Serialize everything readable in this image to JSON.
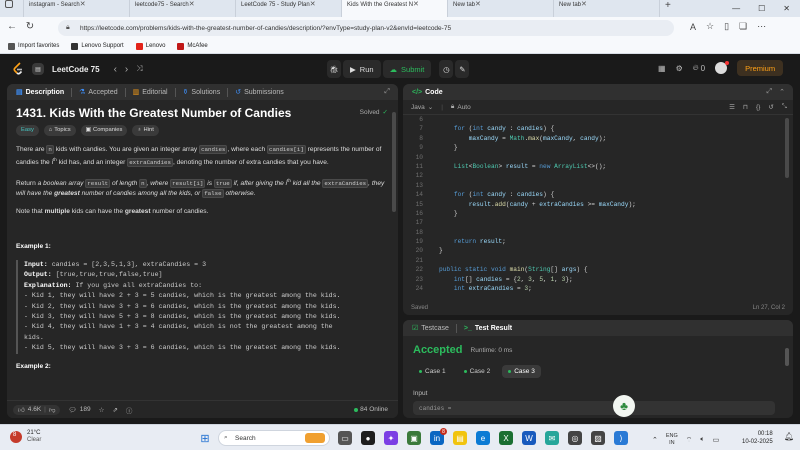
{
  "browser": {
    "tabs": [
      {
        "title": "instagram - Search",
        "active": false,
        "color": "#1a73e8"
      },
      {
        "title": "leetcode75 - Search",
        "active": false,
        "color": "#1a73e8"
      },
      {
        "title": "LeetCode 75 - Study Plan",
        "active": false,
        "color": "#ffa116"
      },
      {
        "title": "Kids With the Greatest N",
        "active": true,
        "color": "#ffa116"
      },
      {
        "title": "New tab",
        "active": false,
        "color": "#888888"
      },
      {
        "title": "New tab",
        "active": false,
        "color": "#888888"
      }
    ],
    "new_tab": "+",
    "url": "https://leetcode.com/problems/kids-with-the-greatest-number-of-candies/description/?envType=study-plan-v2&envId=leetcode-75",
    "bookmarks": [
      {
        "label": "Import favorites",
        "color": "#555555"
      },
      {
        "label": "Lenovo Support",
        "color": "#333333"
      },
      {
        "label": "Lenovo",
        "color": "#e2231a"
      },
      {
        "label": "McAfee",
        "color": "#c01818"
      }
    ]
  },
  "lc_header": {
    "title": "LeetCode 75",
    "run": "Run",
    "submit": "Submit",
    "streak": "0",
    "premium": "Premium"
  },
  "description": {
    "tabs": [
      "Description",
      "Accepted",
      "Editorial",
      "Solutions",
      "Submissions"
    ],
    "problem_title": "1431. Kids With the Greatest Number of Candies",
    "status": "Solved",
    "pills": [
      "Easy",
      "Topics",
      "Companies",
      "Hint"
    ],
    "p1": {
      "a": "There are ",
      "n": "n",
      "b": " kids with candies. You are given an integer array ",
      "candies": "candies",
      "c": ", where each ",
      "candies_i": "candies[i]",
      "d": " represents the number of candies the ",
      "ith": "i",
      "th": "th",
      "e": " kid has, and an integer ",
      "extra": "extraCandies",
      "f": ", denoting the number of extra candies that you have."
    },
    "p2": {
      "a": "Return ",
      "b": "a boolean array ",
      "result": "result",
      "c": " of length ",
      "n": "n",
      "d": ", where ",
      "result_i": "result[i]",
      "e": " is ",
      "true": "true",
      "f": " if, after giving the ",
      "ith": "i",
      "th": "th",
      "g": " kid all the ",
      "extra": "extraCandies",
      "h": ", they will have the ",
      "greatest": "greatest",
      "i": " number of candies among all the kids, or ",
      "false": "false",
      "j": " otherwise."
    },
    "p3": {
      "a": "Note that ",
      "multiple": "multiple",
      "b": " kids can have the ",
      "greatest": "greatest",
      "c": " number of candies."
    },
    "example1_title": "Example 1:",
    "example1": {
      "input_label": "Input:",
      "input": " candies = [2,3,5,1,3], extraCandies = 3",
      "output_label": "Output:",
      "output": " [true,true,true,false,true]",
      "expl_label": "Explanation:",
      "expl": " If you give all extraCandies to:",
      "lines": [
        "- Kid 1, they will have 2 + 3 = 5 candies, which is the greatest among the kids.",
        "- Kid 2, they will have 3 + 3 = 6 candies, which is the greatest among the kids.",
        "- Kid 3, they will have 5 + 3 = 8 candies, which is the greatest among the kids.",
        "- Kid 4, they will have 1 + 3 = 4 candies, which is not the greatest among the",
        "kids.",
        "- Kid 5, they will have 3 + 3 = 6 candies, which is the greatest among the kids."
      ]
    },
    "example2_title": "Example 2:",
    "footer": {
      "likes": "4.6K",
      "comments": "189",
      "online": "84 Online"
    }
  },
  "code": {
    "title": "Code",
    "language": "Java",
    "mode": "Auto",
    "lines": [
      {
        "n": "6",
        "html": ""
      },
      {
        "n": "7",
        "html": "    <span class='kw'>for</span> (<span class='kw'>int</span> <span class='vr'>candy</span> : <span class='vr'>candies</span>) {"
      },
      {
        "n": "8",
        "html": "        <span class='vr'>maxCandy</span> = <span class='ty'>Math</span>.<span class='fn'>max</span>(<span class='vr'>maxCandy</span>, <span class='vr'>candy</span>);"
      },
      {
        "n": "9",
        "html": "    }"
      },
      {
        "n": "10",
        "html": ""
      },
      {
        "n": "11",
        "html": "    <span class='ty'>List</span>&lt;<span class='ty'>Boolean</span>&gt; <span class='vr'>result</span> = <span class='kw'>new</span> <span class='ty'>ArrayList</span>&lt;&gt;();"
      },
      {
        "n": "12",
        "html": ""
      },
      {
        "n": "13",
        "html": ""
      },
      {
        "n": "14",
        "html": "    <span class='kw'>for</span> (<span class='kw'>int</span> <span class='vr'>candy</span> : <span class='vr'>candies</span>) {"
      },
      {
        "n": "15",
        "html": "        <span class='vr'>result</span>.<span class='fn'>add</span>(<span class='vr'>candy</span> + <span class='vr'>extraCandies</span> &gt;= <span class='vr'>maxCandy</span>);"
      },
      {
        "n": "16",
        "html": "    }"
      },
      {
        "n": "17",
        "html": ""
      },
      {
        "n": "18",
        "html": ""
      },
      {
        "n": "19",
        "html": "    <span class='kw'>return</span> <span class='vr'>result</span>;"
      },
      {
        "n": "20",
        "html": "}"
      },
      {
        "n": "21",
        "html": ""
      },
      {
        "n": "22",
        "html": "<span class='kw'>public static void</span> <span class='fn'>main</span>(<span class='ty'>String</span>[] <span class='vr'>args</span>) {"
      },
      {
        "n": "23",
        "html": "    <span class='kw'>int</span>[] <span class='vr'>candies</span> = {<span class='nm'>2</span>, <span class='nm'>3</span>, <span class='nm'>5</span>, <span class='nm'>1</span>, <span class='nm'>3</span>};"
      },
      {
        "n": "24",
        "html": "    <span class='kw'>int</span> <span class='vr'>extraCandies</span> = <span class='nm'>3</span>;"
      }
    ],
    "saved": "Saved",
    "cursor": "Ln 27, Col 2"
  },
  "result": {
    "tabs": [
      "Testcase",
      "Test Result"
    ],
    "status": "Accepted",
    "runtime": "Runtime: 0 ms",
    "cases": [
      "Case 1",
      "Case 2",
      "Case 3"
    ],
    "input_label": "Input",
    "input_peek": "candies ="
  },
  "taskbar": {
    "weather_temp": "21°C",
    "weather_desc": "Clear",
    "search": "Search",
    "lang": "ENG",
    "region": "IN",
    "time": "00:18",
    "date": "10-02-2025",
    "notif_badge": "8"
  }
}
